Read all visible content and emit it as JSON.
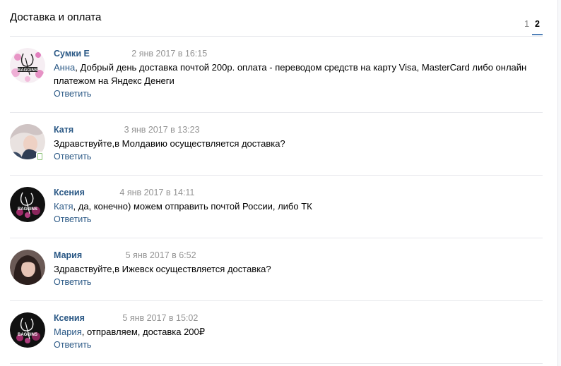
{
  "header": {
    "title": "Доставка и оплата",
    "pages": [
      "1",
      "2"
    ],
    "active_page": "2"
  },
  "comments": [
    {
      "author": "Сумки Е",
      "date": "2 янв 2017 в 16:15",
      "mention": "Анна",
      "text": ", Добрый день доставка почтой 200р. оплата - переводом средств на карту Visa, MasterCard либо онлайн платежом на Яндекс Денеги",
      "reply": "Ответить",
      "avatar": "baggins-logo-pink"
    },
    {
      "author": "Катя",
      "date": "3 янв 2017 в 13:23",
      "mention": "",
      "text": "Здравствуйте,в Молдавию осуществляется доставка?",
      "reply": "Ответить",
      "avatar": "user-photo"
    },
    {
      "author": "Ксения",
      "date": "4 янв 2017 в 14:11",
      "mention": "Катя",
      "text": ", да, конечно) можем отправить почтой России, либо ТК",
      "reply": "Ответить",
      "avatar": "baggins-logo-dark"
    },
    {
      "author": "Мария",
      "date": "5 янв 2017 в 6:52",
      "mention": "",
      "text": "Здравствуйте,в Ижевск осуществляется доставка?",
      "reply": "Ответить",
      "avatar": "user-photo"
    },
    {
      "author": "Ксения",
      "date": "5 янв 2017 в 15:02",
      "mention": "Мария",
      "text": ", отправляем, доставка 200₽",
      "reply": "Ответить",
      "avatar": "baggins-logo-dark"
    }
  ]
}
